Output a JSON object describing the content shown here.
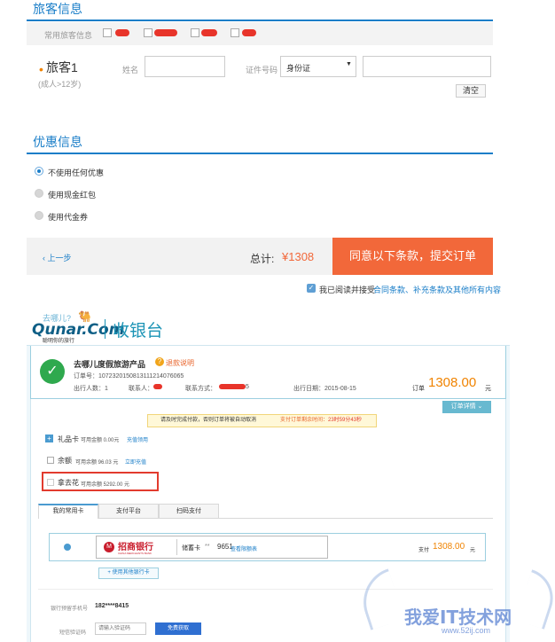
{
  "passenger": {
    "section_title": "旅客信息",
    "common_label": "常用旅客信息",
    "traveler_label": "旅客1",
    "traveler_note": "(成人>12岁)",
    "name_label": "姓名",
    "id_label": "证件号码",
    "id_type": "身份证",
    "clear_button": "清空"
  },
  "discount": {
    "section_title": "优惠信息",
    "options": [
      "不使用任何优惠",
      "使用现金红包",
      "使用代金券"
    ]
  },
  "submit_bar": {
    "back_label": "上一步",
    "total_label": "总计:",
    "total_value": "¥1308",
    "submit_button": "同意以下条款，提交订单",
    "agree_prefix": "我已阅读并接受",
    "agree_link": "合同条款、补充条款及其他所有内容"
  },
  "cashier": {
    "brand_cn": "去哪儿?",
    "brand_logo": "Qunar.Com",
    "brand_slogan": "聪明你的旅行",
    "title": "收银台",
    "product": "去哪儿度假旅游产品",
    "refund_link": "退款说明",
    "order_no": "订单号：107232015081311121407606​5",
    "people": "出行人数：1",
    "contact_label": "联系人：",
    "phone_label": "联系方式：",
    "phone_tail": "5",
    "date": "出行日期：2015-08-15",
    "amount_label": "订单",
    "amount_value": "1308.00",
    "amount_unit": "元",
    "detail_button": "订单详情 ⌄",
    "notice_text": "请及时完成付款，否则订单将被自动取消",
    "notice_countdown_label": "支付订单剩余时间：",
    "notice_countdown": "23时59分43秒",
    "gift_label": "礼品卡",
    "gift_avail": "可用金额 0.00元",
    "gift_link": "充值领用",
    "balance_label": "余额",
    "balance_avail": "可用余额 96.03 元",
    "balance_link": "立即充值",
    "naqu_label": "拿去花",
    "naqu_avail": "可用余额 5292.00 元",
    "tabs": [
      "我的常用卡",
      "支付平台",
      "扫码支付"
    ],
    "bank_name": "招商银行",
    "bank_name_en": "CHINA MERCHANTS BANK",
    "card_type": "储蓄卡",
    "card_mask": "**",
    "card_tail": "9651",
    "limit_link": "查看限额表",
    "pay_label": "支付",
    "pay_value": "1308.00",
    "pay_unit": "元",
    "other_card_button": "+ 使用其他银行卡",
    "phone_reserved_label": "银行预留手机号",
    "phone_reserved_value": "182****8415",
    "sms_label": "短信验证码",
    "sms_placeholder": "请输入验证码",
    "sms_button": "免费获取"
  },
  "watermark": {
    "text": "我爱IT技术网",
    "url": "www.52ij.com"
  },
  "colors": {
    "accent_blue": "#1a7ec8",
    "submit_orange": "#f2683a",
    "price_orange": "#f08300",
    "highlight_red": "#e23b2e"
  }
}
